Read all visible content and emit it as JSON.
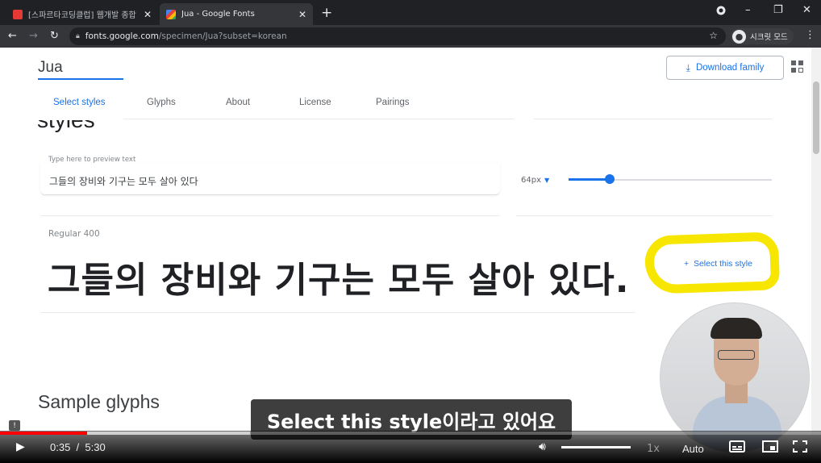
{
  "browser": {
    "tabs": [
      {
        "title": "[스파르타코딩클럽] 웹개발 종합",
        "close": "✕"
      },
      {
        "title": "Jua - Google Fonts",
        "close": "✕"
      }
    ],
    "new_tab": "+",
    "window_controls": {
      "minimize": "–",
      "maximize": "❐",
      "close": "✕"
    },
    "url_host": "fonts.google.com",
    "url_path": "/specimen/Jua?subset=korean",
    "profile_label": "시크릿 모드",
    "colors": {
      "tabbar": "#202124",
      "toolbar": "#35363a"
    }
  },
  "page": {
    "family_name": "Jua",
    "download_label": "Download family",
    "tabs": [
      {
        "label": "Select styles",
        "selected": true
      },
      {
        "label": "Glyphs",
        "selected": false
      },
      {
        "label": "About",
        "selected": false
      },
      {
        "label": "License",
        "selected": false
      },
      {
        "label": "Pairings",
        "selected": false
      }
    ],
    "cut_heading": "styles",
    "preview": {
      "placeholder": "Type here to preview text",
      "value": "그들의 장비와 기구는 모두 살아 있다",
      "size": "64px"
    },
    "style": {
      "label": "Regular 400",
      "sample": "그들의 장비와 기구는 모두 살아 있다.",
      "select_label": "Select this style"
    },
    "glyphs_heading": "Sample glyphs",
    "accent": "#1a73e8",
    "highlight_color": "#f7e700"
  },
  "video": {
    "subtitle": "Select this style이라고 있어요",
    "current_time": "0:35",
    "separator": "/",
    "duration": "5:30",
    "played_fraction": 0.106,
    "speed": "1x",
    "quality": "Auto"
  }
}
